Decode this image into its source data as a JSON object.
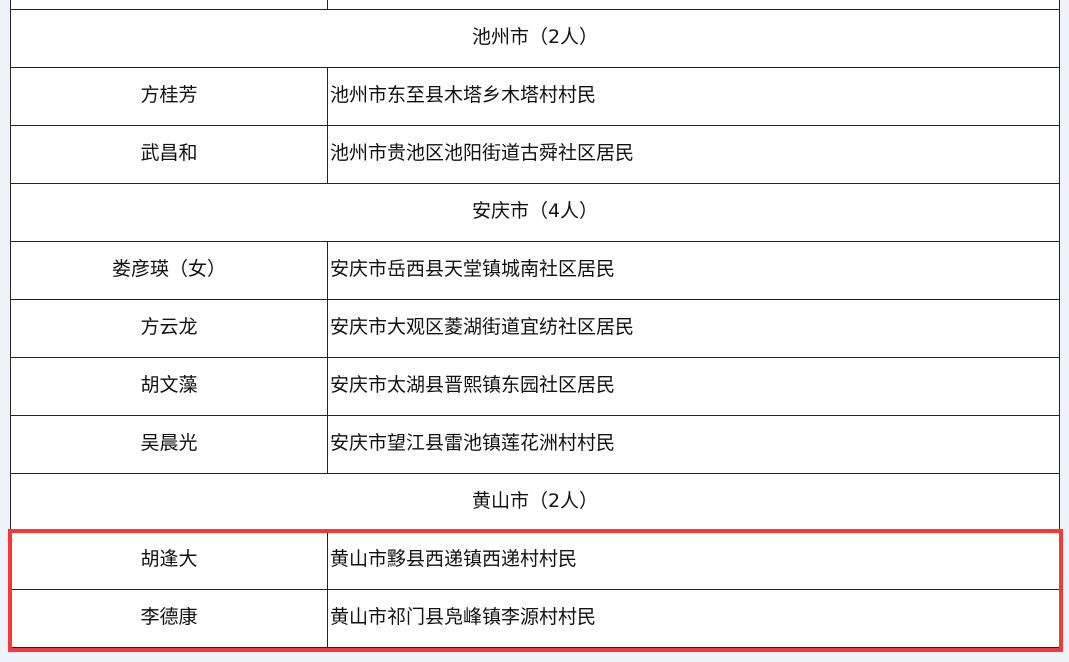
{
  "sections": [
    {
      "title": "",
      "rows": [
        {
          "name": "",
          "address": ""
        }
      ]
    },
    {
      "title": "池州市（2人）",
      "rows": [
        {
          "name": "方桂芳",
          "address": "池州市东至县木塔乡木塔村村民"
        },
        {
          "name": "武昌和",
          "address": "池州市贵池区池阳街道古舜社区居民"
        }
      ]
    },
    {
      "title": "安庆市（4人）",
      "rows": [
        {
          "name": "娄彦瑛（女）",
          "address": "安庆市岳西县天堂镇城南社区居民"
        },
        {
          "name": "方云龙",
          "address": "安庆市大观区菱湖街道宜纺社区居民"
        },
        {
          "name": "胡文藻",
          "address": "安庆市太湖县晋熙镇东园社区居民"
        },
        {
          "name": "吴晨光",
          "address": "安庆市望江县雷池镇莲花洲村村民"
        }
      ]
    },
    {
      "title": "黄山市（2人）",
      "rows": [
        {
          "name": "胡逢大",
          "address": "黄山市黟县西递镇西递村村民"
        },
        {
          "name": "李德康",
          "address": "黄山市祁门县凫峰镇李源村村民"
        }
      ]
    }
  ],
  "highlight_color": "#f23a3a"
}
